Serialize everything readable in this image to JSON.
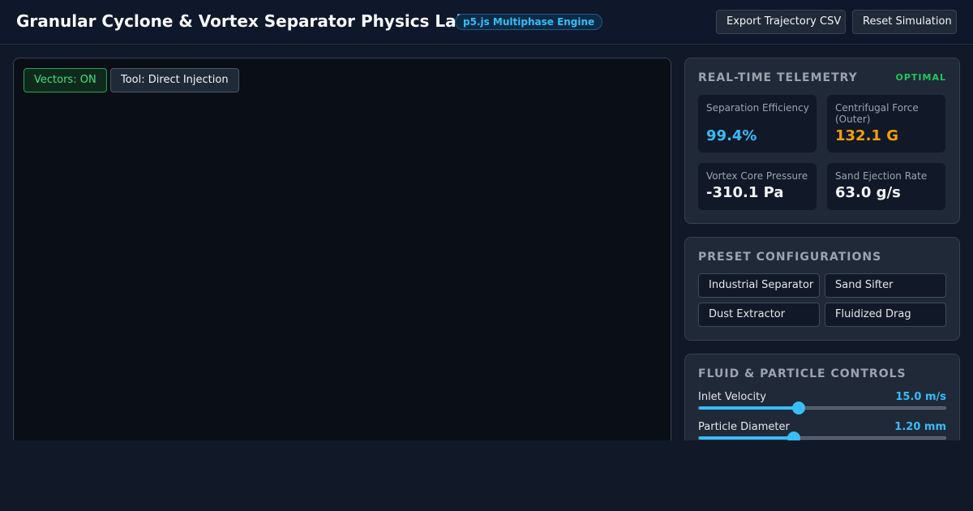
{
  "header": {
    "title": "Granular Cyclone & Vortex Separator Physics Lab",
    "engine_badge": "p5.js Multiphase Engine",
    "export_label": "Export Trajectory CSV",
    "reset_label": "Reset Simulation"
  },
  "simulation": {
    "vectors_label": "Vectors: ON",
    "tool_label": "Tool: Direct Injection"
  },
  "telemetry": {
    "title": "REAL-TIME TELEMETRY",
    "status": "OPTIMAL",
    "status_color": "#22c55e",
    "metrics": [
      {
        "label": "Separation Efficiency",
        "value": "99.4%",
        "color": "#38bdf8"
      },
      {
        "label": "Centrifugal Force (Outer)",
        "value": "132.1 G",
        "color": "#f59e0b"
      },
      {
        "label": "Vortex Core Pressure",
        "value": "-310.1 Pa",
        "color": "#f3f4f6"
      },
      {
        "label": "Sand Ejection Rate",
        "value": "63.0 g/s",
        "color": "#f3f4f6"
      }
    ]
  },
  "presets": {
    "title": "PRESET CONFIGURATIONS",
    "items": [
      "Industrial Separator",
      "Sand Sifter",
      "Dust Extractor",
      "Fluidized Drag"
    ]
  },
  "controls": {
    "title": "FLUID & PARTICLE CONTROLS",
    "sliders": [
      {
        "label": "Inlet Velocity",
        "value": "15.0 m/s",
        "fraction": 0.405
      },
      {
        "label": "Particle Diameter",
        "value": "1.20 mm",
        "fraction": 0.385
      }
    ]
  }
}
